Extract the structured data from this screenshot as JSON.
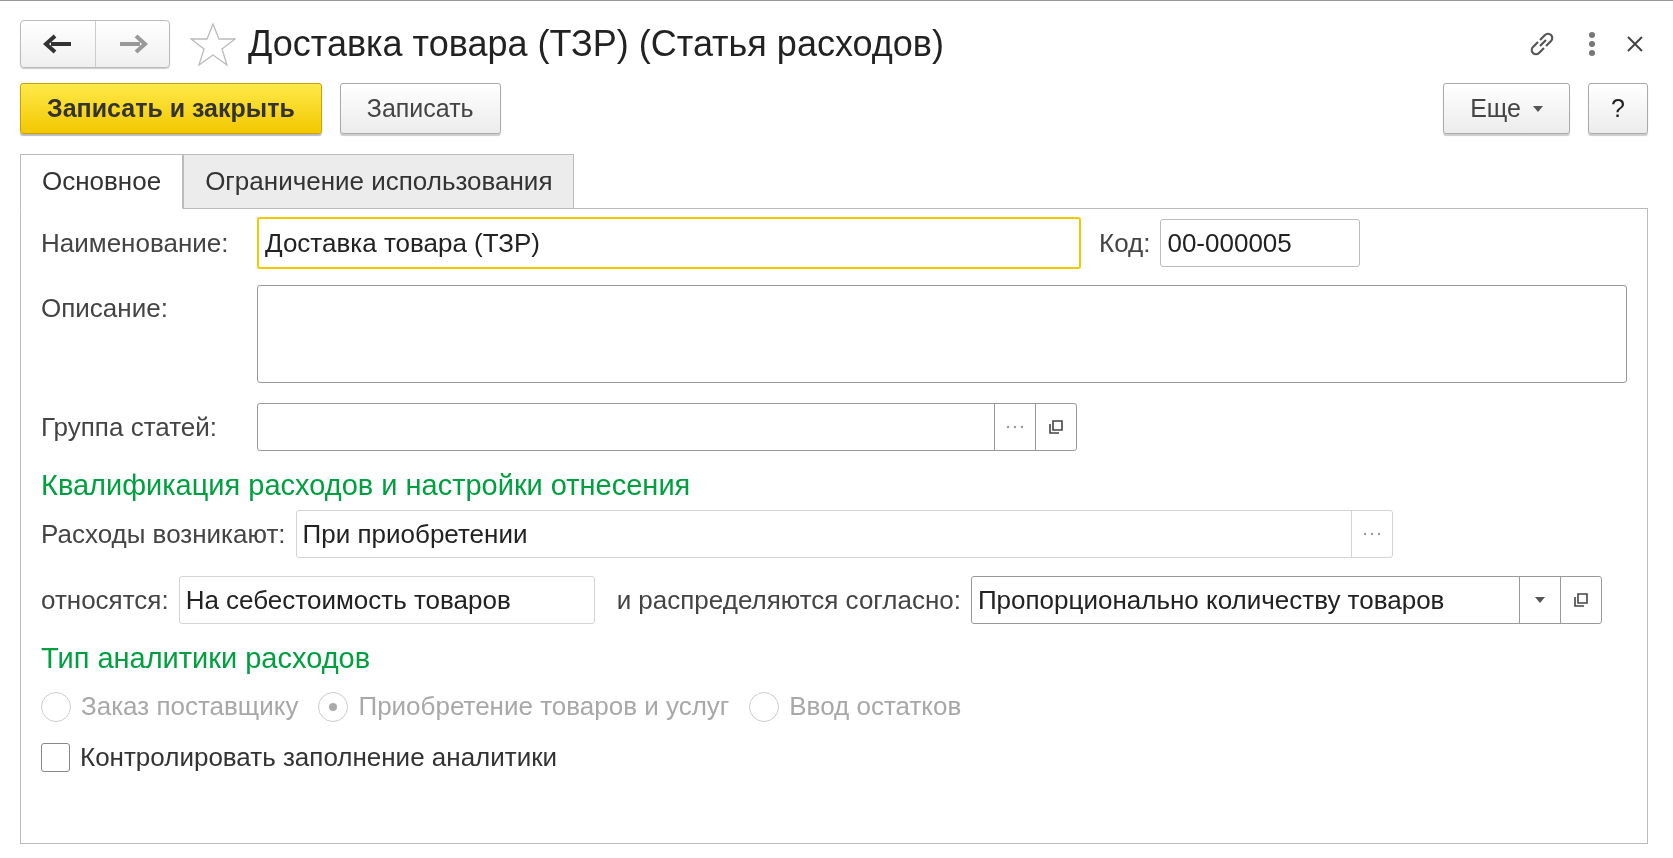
{
  "header": {
    "favorite": false,
    "title": "Доставка товара (ТЗР) (Статья расходов)"
  },
  "toolbar": {
    "buttons": [
      {
        "label": "Записать и закрыть",
        "kind": "primary"
      },
      {
        "label": "Записать",
        "kind": "default"
      }
    ],
    "more": "Еще",
    "help": "?"
  },
  "tabs": [
    {
      "label": "Основное",
      "selected": true
    },
    {
      "label": "Ограничение использования",
      "selected": false
    }
  ],
  "form": {
    "name": {
      "label": "Наименование:",
      "value": "Доставка товара (ТЗР)",
      "focused": true
    },
    "code": {
      "label": "Код:",
      "value": "00-000005"
    },
    "description": {
      "label": "Описание:"
    },
    "group": {
      "label": "Группа статей:"
    },
    "section1": "Квалификация расходов и настройки отнесения",
    "arise": {
      "label": "Расходы возникают:",
      "value": "При приобретении",
      "disabled": true
    },
    "assigned": {
      "label": "относятся:",
      "value": "На себестоимость товаров"
    },
    "distributed": {
      "label": "и распределяются согласно:",
      "value": "Пропорционально количеству товаров"
    },
    "section2": "Тип аналитики расходов",
    "analytics": [
      {
        "label": "Заказ поставщику",
        "selected": false,
        "disabled": true
      },
      {
        "label": "Приобретение товаров и услуг",
        "selected": true,
        "disabled": true
      },
      {
        "label": "Ввод остатков",
        "selected": false,
        "disabled": true
      }
    ],
    "control": {
      "label": "Контролировать заполнение аналитики",
      "checked": false
    }
  }
}
